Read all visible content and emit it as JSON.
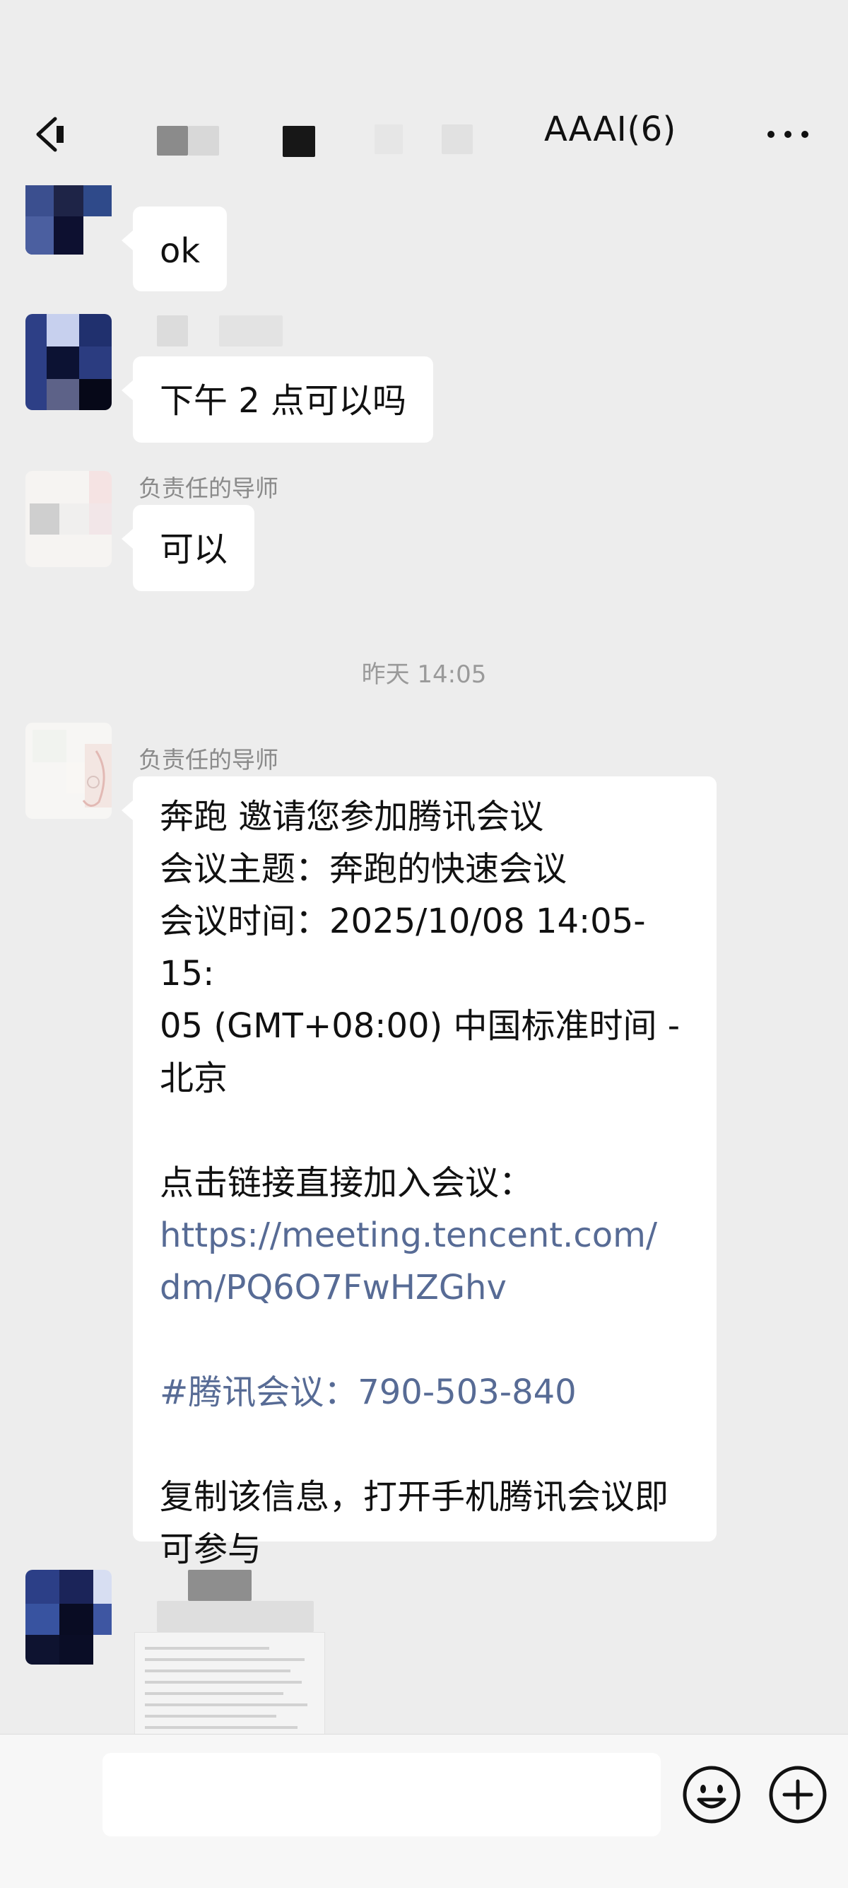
{
  "header": {
    "title_visible": "AAAI(6)",
    "back_icon": "chevron-left-icon",
    "more_icon": "more-dots-icon"
  },
  "messages": [
    {
      "sender": "",
      "text": "ok"
    },
    {
      "sender": "",
      "text": "下午 2 点可以吗"
    },
    {
      "sender": "负责任的导师",
      "text": "可以"
    }
  ],
  "time_separator": "昨天 14:05",
  "invite": {
    "sender": "负责任的导师",
    "line1": "奔跑 邀请您参加腾讯会议",
    "line2": "会议主题：奔跑的快速会议",
    "line3": "会议时间：2025/10/08 14:05-15:",
    "line4": "05 (GMT+08:00) 中国标准时间 -",
    "line5": "北京",
    "join_label": "点击链接直接加入会议：",
    "link_line1": "https://meeting.tencent.com/",
    "link_line2": "dm/PQ6O7FwHZGhv",
    "meeting_id": "#腾讯会议：790-503-840",
    "copy_line1": "复制该信息，打开手机腾讯会议即",
    "copy_line2": "可参与"
  },
  "input": {
    "placeholder": "",
    "emoji_icon": "emoji-icon",
    "plus_icon": "plus-circle-icon"
  },
  "colors": {
    "background": "#ededed",
    "bubble": "#ffffff",
    "link": "#576b95",
    "meta_text": "#8a8a8a"
  }
}
